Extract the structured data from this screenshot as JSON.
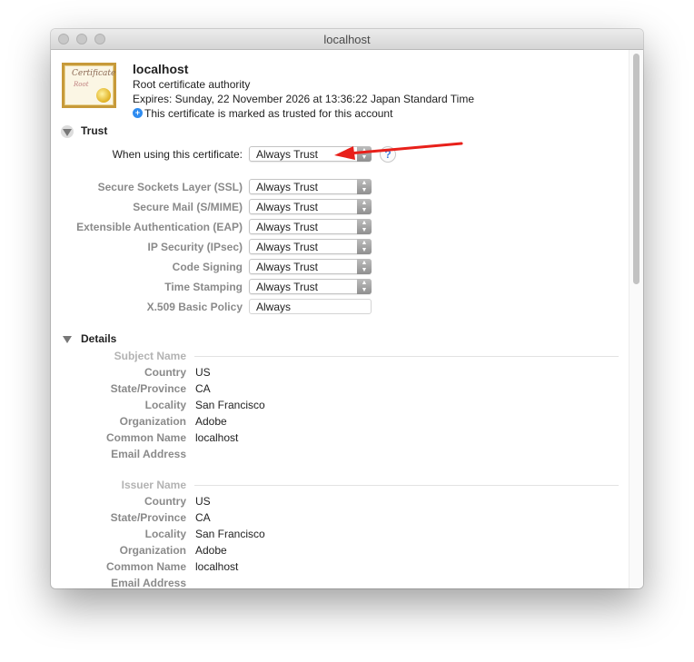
{
  "window": {
    "title": "localhost"
  },
  "header": {
    "name": "localhost",
    "type": "Root certificate authority",
    "expires": "Expires: Sunday, 22 November 2026 at 13:36:22 Japan Standard Time",
    "trusted_note": "This certificate is marked as trusted for this account",
    "icon_script": "Certificate",
    "icon_root": "Root"
  },
  "trust": {
    "section_label": "Trust",
    "main_label": "When using this certificate:",
    "main_value": "Always Trust",
    "help_label": "?",
    "policies": [
      {
        "label": "Secure Sockets Layer (SSL)",
        "value": "Always Trust"
      },
      {
        "label": "Secure Mail (S/MIME)",
        "value": "Always Trust"
      },
      {
        "label": "Extensible Authentication (EAP)",
        "value": "Always Trust"
      },
      {
        "label": "IP Security (IPsec)",
        "value": "Always Trust"
      },
      {
        "label": "Code Signing",
        "value": "Always Trust"
      },
      {
        "label": "Time Stamping",
        "value": "Always Trust"
      },
      {
        "label": "X.509 Basic Policy",
        "value": "Always"
      }
    ]
  },
  "details": {
    "section_label": "Details",
    "subject": {
      "heading": "Subject Name",
      "rows": [
        {
          "label": "Country",
          "value": "US"
        },
        {
          "label": "State/Province",
          "value": "CA"
        },
        {
          "label": "Locality",
          "value": "San Francisco"
        },
        {
          "label": "Organization",
          "value": "Adobe"
        },
        {
          "label": "Common Name",
          "value": "localhost"
        },
        {
          "label": "Email Address",
          "value": ""
        }
      ]
    },
    "issuer": {
      "heading": "Issuer Name",
      "rows": [
        {
          "label": "Country",
          "value": "US"
        },
        {
          "label": "State/Province",
          "value": "CA"
        },
        {
          "label": "Locality",
          "value": "San Francisco"
        },
        {
          "label": "Organization",
          "value": "Adobe"
        },
        {
          "label": "Common Name",
          "value": "localhost"
        },
        {
          "label": "Email Address",
          "value": ""
        }
      ]
    }
  },
  "colors": {
    "accent": "#2f74e8",
    "annotation_arrow": "#e8201a",
    "info": "#2f8cf0"
  },
  "icons": [
    "certificate-icon",
    "info-icon",
    "disclosure-triangle-icon",
    "help-icon",
    "popup-stepper-icon",
    "annotation-arrow-icon"
  ]
}
